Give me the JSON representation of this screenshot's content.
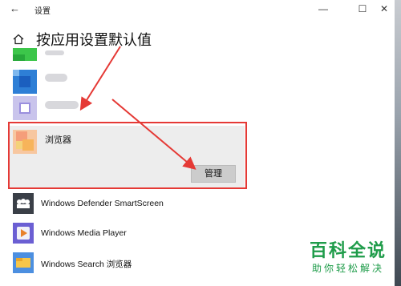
{
  "window": {
    "title": "设置",
    "back_icon": "back-arrow-icon",
    "minimize_glyph": "—",
    "maximize_glyph": "☐",
    "close_glyph": "✕"
  },
  "page": {
    "heading": "按应用设置默认值",
    "home_icon": "home-icon"
  },
  "selected_app": {
    "label": "浏览器",
    "manage_button": "管理"
  },
  "apps": [
    {
      "label": "Windows Defender SmartScreen",
      "icon": "defender-smartscreen-icon"
    },
    {
      "label": "Windows Media Player",
      "icon": "media-player-icon"
    },
    {
      "label": "Windows Search 浏览器",
      "icon": "search-browser-icon"
    }
  ],
  "watermark": {
    "title": "百科全说",
    "subtitle": "助你轻松解决"
  },
  "colors": {
    "annotation_red": "#e53935",
    "watermark_green": "#1f9c4a",
    "selected_bg": "#ededed"
  }
}
